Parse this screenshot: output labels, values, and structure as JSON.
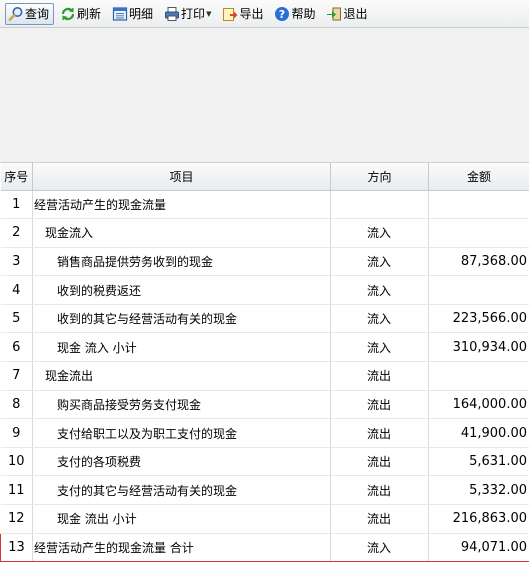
{
  "toolbar": {
    "query": "查询",
    "refresh": "刷新",
    "detail": "明细",
    "print": "打印",
    "export": "导出",
    "help": "帮助",
    "exit": "退出"
  },
  "table": {
    "headers": {
      "seq": "序号",
      "item": "项目",
      "direction": "方向",
      "amount": "金额"
    },
    "rows": [
      {
        "seq": "1",
        "item": "经营活动产生的现金流量",
        "direction": "",
        "amount": ""
      },
      {
        "seq": "2",
        "item": "现金流入",
        "direction": "流入",
        "amount": ""
      },
      {
        "seq": "3",
        "item": "销售商品提供劳务收到的现金",
        "direction": "流入",
        "amount": "87,368.00"
      },
      {
        "seq": "4",
        "item": "收到的税费返还",
        "direction": "流入",
        "amount": ""
      },
      {
        "seq": "5",
        "item": "收到的其它与经营活动有关的现金",
        "direction": "流入",
        "amount": "223,566.00"
      },
      {
        "seq": "6",
        "item": "现金 流入 小计",
        "direction": "流入",
        "amount": "310,934.00"
      },
      {
        "seq": "7",
        "item": "现金流出",
        "direction": "流出",
        "amount": ""
      },
      {
        "seq": "8",
        "item": "购买商品接受劳务支付现金",
        "direction": "流出",
        "amount": "164,000.00"
      },
      {
        "seq": "9",
        "item": "支付给职工以及为职工支付的现金",
        "direction": "流出",
        "amount": "41,900.00"
      },
      {
        "seq": "10",
        "item": "支付的各项税费",
        "direction": "流出",
        "amount": "5,631.00"
      },
      {
        "seq": "11",
        "item": "支付的其它与经营活动有关的现金",
        "direction": "流出",
        "amount": "5,332.00"
      },
      {
        "seq": "12",
        "item": "现金 流出 小计",
        "direction": "流出",
        "amount": "216,863.00"
      },
      {
        "seq": "13",
        "item": "经营活动产生的现金流量 合计",
        "direction": "流入",
        "amount": "94,071.00"
      }
    ]
  },
  "colors": {
    "selected_border": "#e0323a",
    "help_icon": "#2a6fd6",
    "refresh_icon": "#2e9b2e"
  }
}
